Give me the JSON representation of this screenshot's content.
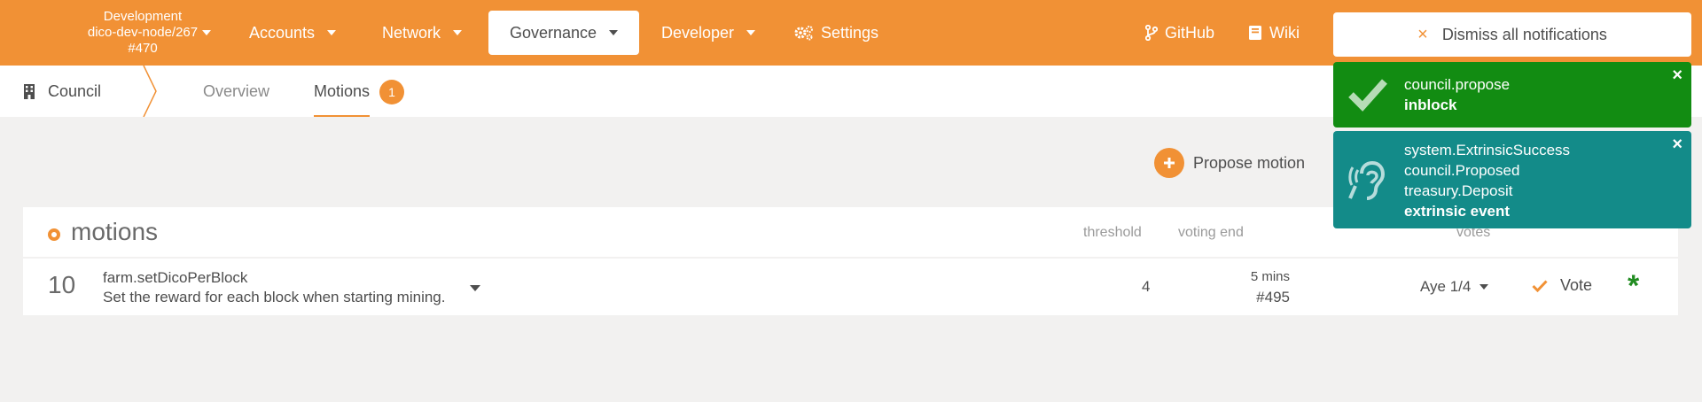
{
  "header": {
    "chain": {
      "line1": "Development",
      "line2": "dico-dev-node/267",
      "line3": "#470"
    },
    "menu": [
      {
        "label": "Accounts"
      },
      {
        "label": "Network"
      },
      {
        "label": "Governance"
      },
      {
        "label": "Developer"
      },
      {
        "label": "Settings"
      }
    ],
    "links": [
      {
        "label": "GitHub"
      },
      {
        "label": "Wiki"
      }
    ]
  },
  "subnav": {
    "section": "Council",
    "tabs": [
      {
        "label": "Overview"
      },
      {
        "label": "Motions"
      }
    ],
    "motions_badge": "1"
  },
  "actions": {
    "propose": "Propose motion"
  },
  "table": {
    "title": "motions",
    "headers": {
      "threshold": "threshold",
      "voting_end": "voting end",
      "votes": "votes"
    },
    "rows": [
      {
        "index": "10",
        "call": "farm.setDicoPerBlock",
        "description": "Set the reward for each block when starting mining.",
        "threshold": "4",
        "voting_end_time": "5 mins",
        "voting_end_block": "#495",
        "aye": "Aye 1/4",
        "vote": "Vote",
        "marker": "*"
      }
    ]
  },
  "notifications": {
    "dismiss_all": "Dismiss all notifications",
    "dismiss_icon": "×",
    "close_icon": "×",
    "items": [
      {
        "lines": [
          "council.propose"
        ],
        "status": "inblock",
        "color": "#128c12",
        "icon": "check-icon"
      },
      {
        "lines": [
          "system.ExtrinsicSuccess",
          "council.Proposed",
          "treasury.Deposit"
        ],
        "status": "extrinsic event",
        "color": "#138b89",
        "icon": "ear-icon"
      }
    ]
  },
  "colors": {
    "brand": "#f19135",
    "success": "#128c12",
    "info": "#138b89",
    "aye_marker": "#218c21"
  }
}
